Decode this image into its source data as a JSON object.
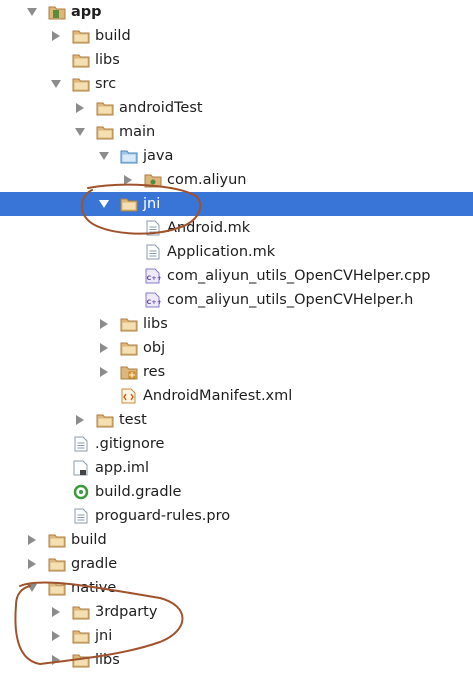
{
  "tree": [
    {
      "label": "app",
      "depth": 0,
      "arrow": "down",
      "icon": "module-icon",
      "bold": true
    },
    {
      "label": "build",
      "depth": 1,
      "arrow": "right",
      "icon": "folder-icon"
    },
    {
      "label": "libs",
      "depth": 1,
      "arrow": "none",
      "icon": "folder-icon"
    },
    {
      "label": "src",
      "depth": 1,
      "arrow": "down",
      "icon": "folder-icon"
    },
    {
      "label": "androidTest",
      "depth": 2,
      "arrow": "right",
      "icon": "folder-icon"
    },
    {
      "label": "main",
      "depth": 2,
      "arrow": "down",
      "icon": "folder-icon"
    },
    {
      "label": "java",
      "depth": 3,
      "arrow": "down",
      "icon": "source-folder-icon"
    },
    {
      "label": "com.aliyun",
      "depth": 4,
      "arrow": "right",
      "icon": "package-icon"
    },
    {
      "label": "jni",
      "depth": 3,
      "arrow": "down",
      "icon": "folder-icon",
      "selected": true
    },
    {
      "label": "Android.mk",
      "depth": 4,
      "arrow": "none",
      "icon": "text-file-icon"
    },
    {
      "label": "Application.mk",
      "depth": 4,
      "arrow": "none",
      "icon": "text-file-icon"
    },
    {
      "label": "com_aliyun_utils_OpenCVHelper.cpp",
      "depth": 4,
      "arrow": "none",
      "icon": "cpp-file-icon"
    },
    {
      "label": "com_aliyun_utils_OpenCVHelper.h",
      "depth": 4,
      "arrow": "none",
      "icon": "header-file-icon"
    },
    {
      "label": "libs",
      "depth": 3,
      "arrow": "right",
      "icon": "folder-icon"
    },
    {
      "label": "obj",
      "depth": 3,
      "arrow": "right",
      "icon": "folder-icon"
    },
    {
      "label": "res",
      "depth": 3,
      "arrow": "right",
      "icon": "resource-folder-icon"
    },
    {
      "label": "AndroidManifest.xml",
      "depth": 3,
      "arrow": "none",
      "icon": "xml-file-icon"
    },
    {
      "label": "test",
      "depth": 2,
      "arrow": "right",
      "icon": "folder-icon"
    },
    {
      "label": ".gitignore",
      "depth": 1,
      "arrow": "none",
      "icon": "text-file-icon"
    },
    {
      "label": "app.iml",
      "depth": 1,
      "arrow": "none",
      "icon": "iml-file-icon"
    },
    {
      "label": "build.gradle",
      "depth": 1,
      "arrow": "none",
      "icon": "gradle-file-icon"
    },
    {
      "label": "proguard-rules.pro",
      "depth": 1,
      "arrow": "none",
      "icon": "text-file-icon"
    },
    {
      "label": "build",
      "depth": 0,
      "arrow": "right",
      "icon": "folder-icon"
    },
    {
      "label": "gradle",
      "depth": 0,
      "arrow": "right",
      "icon": "folder-icon"
    },
    {
      "label": "native",
      "depth": 0,
      "arrow": "down",
      "icon": "folder-icon"
    },
    {
      "label": "3rdparty",
      "depth": 1,
      "arrow": "right",
      "icon": "folder-icon"
    },
    {
      "label": "jni",
      "depth": 1,
      "arrow": "right",
      "icon": "folder-icon"
    },
    {
      "label": "libs",
      "depth": 1,
      "arrow": "right",
      "icon": "folder-icon"
    }
  ],
  "colors": {
    "selection": "#3875d7",
    "folder": "#dcb67a",
    "annotation": "#a0522d"
  }
}
